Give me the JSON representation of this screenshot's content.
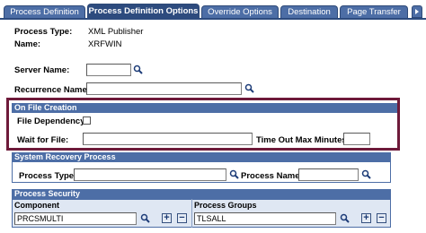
{
  "tabs": [
    {
      "label": "Process Definition",
      "active": false
    },
    {
      "label": "Process Definition Options",
      "active": true
    },
    {
      "label": "Override Options",
      "active": false
    },
    {
      "label": "Destination",
      "active": false
    },
    {
      "label": "Page Transfer",
      "active": false
    }
  ],
  "header": {
    "process_type_label": "Process Type:",
    "process_type_value": "XML Publisher",
    "name_label": "Name:",
    "name_value": "XRFWIN"
  },
  "fields": {
    "server_name_label": "Server Name:",
    "server_name_value": "",
    "recurrence_name_label": "Recurrence Name:",
    "recurrence_name_value": ""
  },
  "on_file_creation": {
    "title": "On File Creation",
    "file_dependency_label": "File Dependency:",
    "file_dependency_checked": false,
    "wait_for_file_label": "Wait for File:",
    "wait_for_file_value": "",
    "timeout_label": "Time Out Max Minutes:",
    "timeout_value": ""
  },
  "system_recovery": {
    "title": "System Recovery Process",
    "process_type_label": "Process Type:",
    "process_type_value": "",
    "process_name_label": "Process Name:",
    "process_name_value": ""
  },
  "process_security": {
    "title": "Process Security",
    "component_header": "Component",
    "groups_header": "Process Groups",
    "component_value": "PRCSMULTI",
    "group_value": "TLSALL"
  },
  "icons": {
    "lookup": "magnifier-icon",
    "add": "+",
    "remove": "−",
    "scroll": "tab-scroll-right-icon"
  },
  "colors": {
    "tab_bg": "#4d6ea6",
    "active_tab_bg": "#2d4b7e",
    "section_bar": "#4d6ea6",
    "highlight_border": "#6e1a3a",
    "grid_bg": "#dfe7f3"
  }
}
